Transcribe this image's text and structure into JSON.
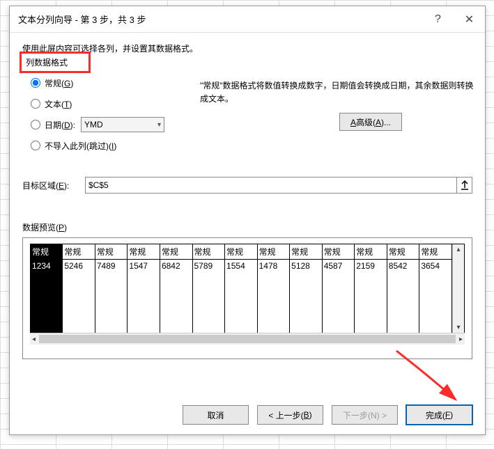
{
  "titlebar": {
    "title": "文本分列向导 - 第 3 步，共 3 步",
    "help": "?",
    "close": "✕"
  },
  "description": "使用此屏内容可选择各列，并设置其数据格式。",
  "fieldset_legend": "列数据格式",
  "radios": {
    "general": "常规(",
    "general_u": "G",
    "general_end": ")",
    "text": "文本(",
    "text_u": "T",
    "text_end": ")",
    "date": "日期(",
    "date_u": "D",
    "date_end": "):",
    "date_value": "YMD",
    "skip": "不导入此列(跳过)(",
    "skip_u": "I",
    "skip_end": ")"
  },
  "info_text": "\"常规\"数据格式将数值转换成数字，日期值会转换成日期，其余数据则转换成文本。",
  "advanced_btn": "高级(A)...",
  "destination": {
    "label": "目标区域(E):",
    "value": "$C$5"
  },
  "preview_label": "数据预览(P)",
  "chart_data": {
    "type": "table",
    "headers": [
      "常规",
      "常规",
      "常规",
      "常规",
      "常规",
      "常规",
      "常规",
      "常规",
      "常规",
      "常规",
      "常规",
      "常规",
      "常规"
    ],
    "rows": [
      [
        "1234",
        "5246",
        "7489",
        "1547",
        "6842",
        "5789",
        "1554",
        "1478",
        "5128",
        "4587",
        "2159",
        "8542",
        "3654"
      ]
    ]
  },
  "buttons": {
    "cancel": "取消",
    "back": "< 上一步(B)",
    "next": "下一步(N) >",
    "finish": "完成(F)"
  }
}
